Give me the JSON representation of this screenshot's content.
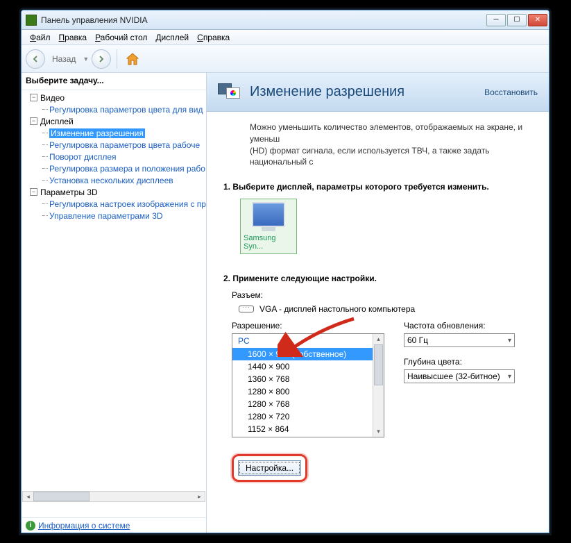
{
  "window": {
    "title": "Панель управления NVIDIA"
  },
  "menu": {
    "file": "Файл",
    "edit": "Правка",
    "desktop": "Рабочий стол",
    "display": "Дисплей",
    "help": "Справка"
  },
  "toolbar": {
    "back": "Назад"
  },
  "tree": {
    "header": "Выберите задачу...",
    "cat_video": "Видео",
    "video_1": "Регулировка параметров цвета для вид",
    "cat_display": "Дисплей",
    "disp_1": "Изменение разрешения",
    "disp_2": "Регулировка параметров цвета рабоче",
    "disp_3": "Поворот дисплея",
    "disp_4": "Регулировка размера и положения рабо",
    "disp_5": "Установка нескольких дисплеев",
    "cat_3d": "Параметры 3D",
    "p3d_1": "Регулировка настроек изображения с пр",
    "p3d_2": "Управление параметрами 3D",
    "footer": "Информация о системе"
  },
  "header": {
    "title": "Изменение разрешения",
    "restore": "Восстановить"
  },
  "content": {
    "desc1": "Можно уменьшить количество элементов, отображаемых на экране, и уменьш",
    "desc2": "(HD) формат сигнала, если используется ТВЧ, а также задать национальный с",
    "step1": "1. Выберите дисплей, параметры которого требуется изменить.",
    "display_name": "Samsung Syn...",
    "step2": "2. Примените следующие настройки.",
    "connector_label": "Разъем:",
    "connector_value": "VGA - дисплей настольного компьютера",
    "resolution_label": "Разрешение:",
    "res_head": "PC",
    "res_items": [
      "1600 × 900 (собственное)",
      "1440 × 900",
      "1360 × 768",
      "1280 × 800",
      "1280 × 768",
      "1280 × 720",
      "1152 × 864"
    ],
    "refresh_label": "Частота обновления:",
    "refresh_value": "60 Гц",
    "depth_label": "Глубина цвета:",
    "depth_value": "Наивысшее (32-битное)",
    "config_btn": "Настройка..."
  }
}
